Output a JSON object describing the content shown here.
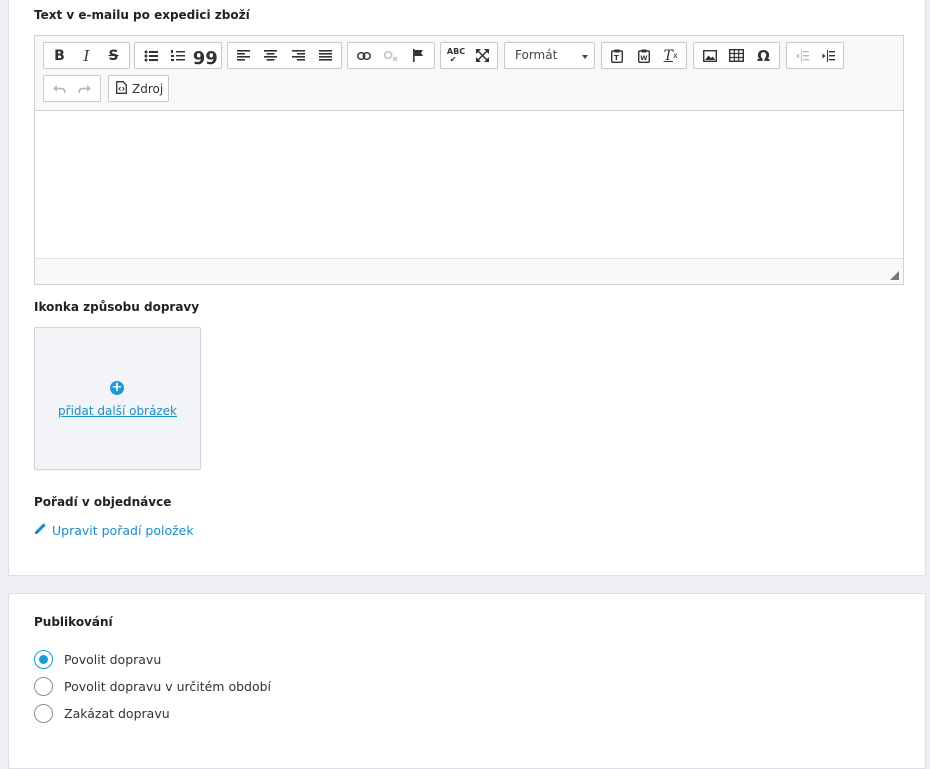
{
  "email_text": {
    "label": "Text v e-mailu po expedici zboží",
    "toolbar": {
      "format_label": "Formát",
      "source_label": "Zdroj",
      "icons": [
        "bold-icon",
        "italic-icon",
        "strikethrough-icon",
        "bullet-list-icon",
        "numbered-list-icon",
        "blockquote-icon",
        "align-left-icon",
        "align-center-icon",
        "align-right-icon",
        "justify-icon",
        "link-icon",
        "unlink-icon",
        "anchor-flag-icon",
        "spellcheck-icon",
        "maximize-icon",
        "paste-icon",
        "paste-word-icon",
        "remove-format-icon",
        "image-icon",
        "table-icon",
        "special-char-icon",
        "outdent-icon",
        "indent-icon",
        "undo-icon",
        "redo-icon",
        "source-icon"
      ]
    }
  },
  "shipping_icon": {
    "label": "Ikonka způsobu dopravy",
    "add_image_link": "přidat další obrázek"
  },
  "order": {
    "label": "Pořadí v objednávce",
    "edit_link": "Upravit pořadí položek"
  },
  "publishing": {
    "label": "Publikování",
    "options": [
      {
        "label": "Povolit dopravu",
        "checked": true
      },
      {
        "label": "Povolit dopravu v určitém období",
        "checked": false
      },
      {
        "label": "Zakázat dopravu",
        "checked": false
      }
    ]
  },
  "colors": {
    "accent": "#1a9bd7",
    "link": "#1a8fc9"
  }
}
